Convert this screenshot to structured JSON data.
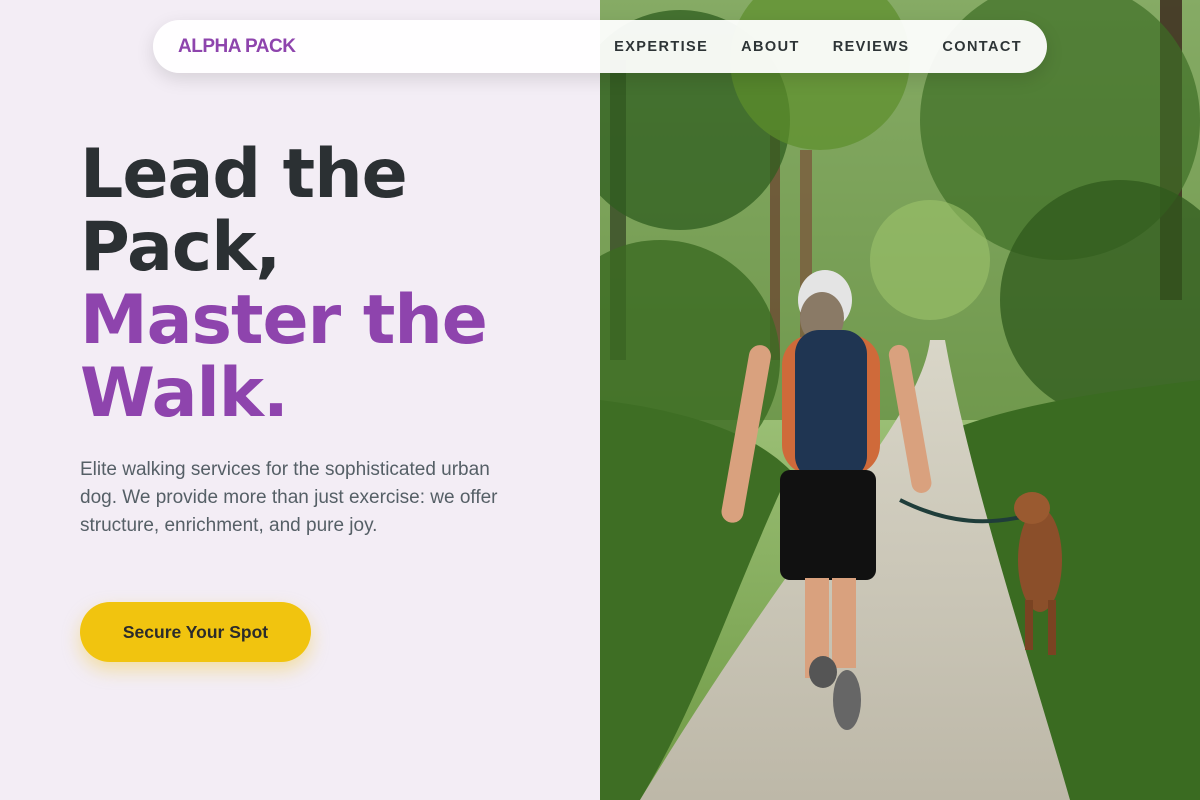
{
  "brand": {
    "name": "ALPHA PACK"
  },
  "nav": {
    "items": [
      {
        "label": "EXPERTISE"
      },
      {
        "label": "ABOUT"
      },
      {
        "label": "REVIEWS"
      },
      {
        "label": "CONTACT"
      }
    ]
  },
  "hero": {
    "headline_dark_1": "Lead the",
    "headline_dark_2": "Pack,",
    "headline_accent_1": "Master the",
    "headline_accent_2": "Walk.",
    "subtext": "Elite walking services for the sophisticated urban dog. We provide more than just exercise: we offer structure, enrichment, and pure joy.",
    "cta_label": "Secure Your Spot"
  },
  "colors": {
    "accent": "#8e44ad",
    "cta": "#f1c40f",
    "background": "#f3edf5",
    "text_dark": "#2b3033"
  },
  "image": {
    "subject": "woman-walking-dog-on-forest-trail"
  }
}
